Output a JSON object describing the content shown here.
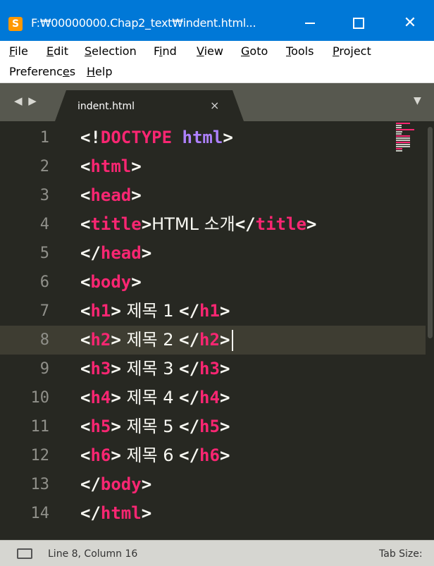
{
  "window": {
    "title": "F:₩00000000.Chap2_text₩indent.html...",
    "minimize": "",
    "maximize": "",
    "close": "✕"
  },
  "menu": {
    "items": [
      {
        "label": "File"
      },
      {
        "label": "Edit"
      },
      {
        "label": "Selection"
      },
      {
        "label": "Find"
      },
      {
        "label": "View"
      },
      {
        "label": "Goto"
      },
      {
        "label": "Tools"
      },
      {
        "label": "Project"
      },
      {
        "label": "Preferences"
      },
      {
        "label": "Help"
      }
    ]
  },
  "tabs": {
    "nav_arrows": "◀ ▶",
    "active": {
      "label": "indent.html",
      "close": "×"
    },
    "dropdown": "▼"
  },
  "editor": {
    "current_line": 8,
    "lines": [
      {
        "num": "1",
        "text": "<!DOCTYPE html>"
      },
      {
        "num": "2",
        "text": "<html>"
      },
      {
        "num": "3",
        "text": "<head>"
      },
      {
        "num": "4",
        "text": "<title>HTML 소개</title>"
      },
      {
        "num": "5",
        "text": "</head>"
      },
      {
        "num": "6",
        "text": "<body>"
      },
      {
        "num": "7",
        "text": "<h1> 제목 1 </h1>"
      },
      {
        "num": "8",
        "text": "<h2> 제목 2 </h2>"
      },
      {
        "num": "9",
        "text": "<h3> 제목 3 </h3>"
      },
      {
        "num": "10",
        "text": "<h4> 제목 4 </h4>"
      },
      {
        "num": "11",
        "text": "<h5> 제목 5 </h5>"
      },
      {
        "num": "12",
        "text": "<h6> 제목 6 </h6>"
      },
      {
        "num": "13",
        "text": "</body>"
      },
      {
        "num": "14",
        "text": "</html>"
      }
    ]
  },
  "status": {
    "position": "Line 8, Column 16",
    "tab_size": "Tab Size:"
  },
  "colors": {
    "background": "#272822",
    "tag": "#f92672",
    "doctype_keyword": "#ae81ff",
    "text": "#f8f8f2",
    "line_number": "#90908a",
    "title_bar": "#0078d7"
  }
}
